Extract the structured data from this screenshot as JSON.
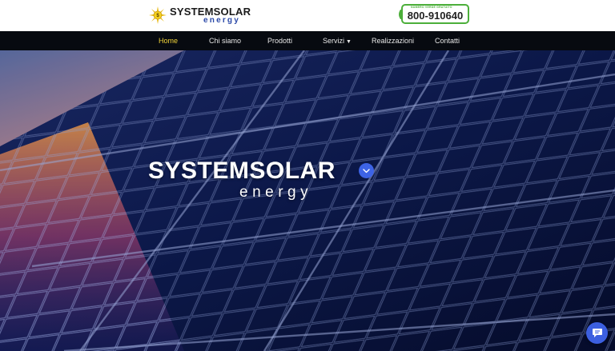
{
  "header": {
    "logo": {
      "title": "SYSTEMSOLAR",
      "subtitle": "energy"
    },
    "phone": {
      "caption": "NUMERO VERDE GRATUITO",
      "number": "800-910640"
    }
  },
  "nav": {
    "items": [
      {
        "label": "Home",
        "active": true
      },
      {
        "label": "Chi siamo"
      },
      {
        "label": "Prodotti"
      },
      {
        "label": "Servizi",
        "has_dropdown": true
      },
      {
        "label": "Realizzazioni"
      },
      {
        "label": "Contatti"
      }
    ]
  },
  "hero": {
    "title": "SYSTEMSOLAR",
    "subtitle": "energy"
  },
  "colors": {
    "nav_bg": "#070a10",
    "nav_active": "#f2d43a",
    "phone_border": "#4caf3a",
    "accent_blue": "#3d63e6"
  },
  "icons": {
    "logo": "sun-icon",
    "scroll": "chevron-down-icon",
    "chat": "chat-bubble-icon",
    "phone": "phone-icon"
  }
}
